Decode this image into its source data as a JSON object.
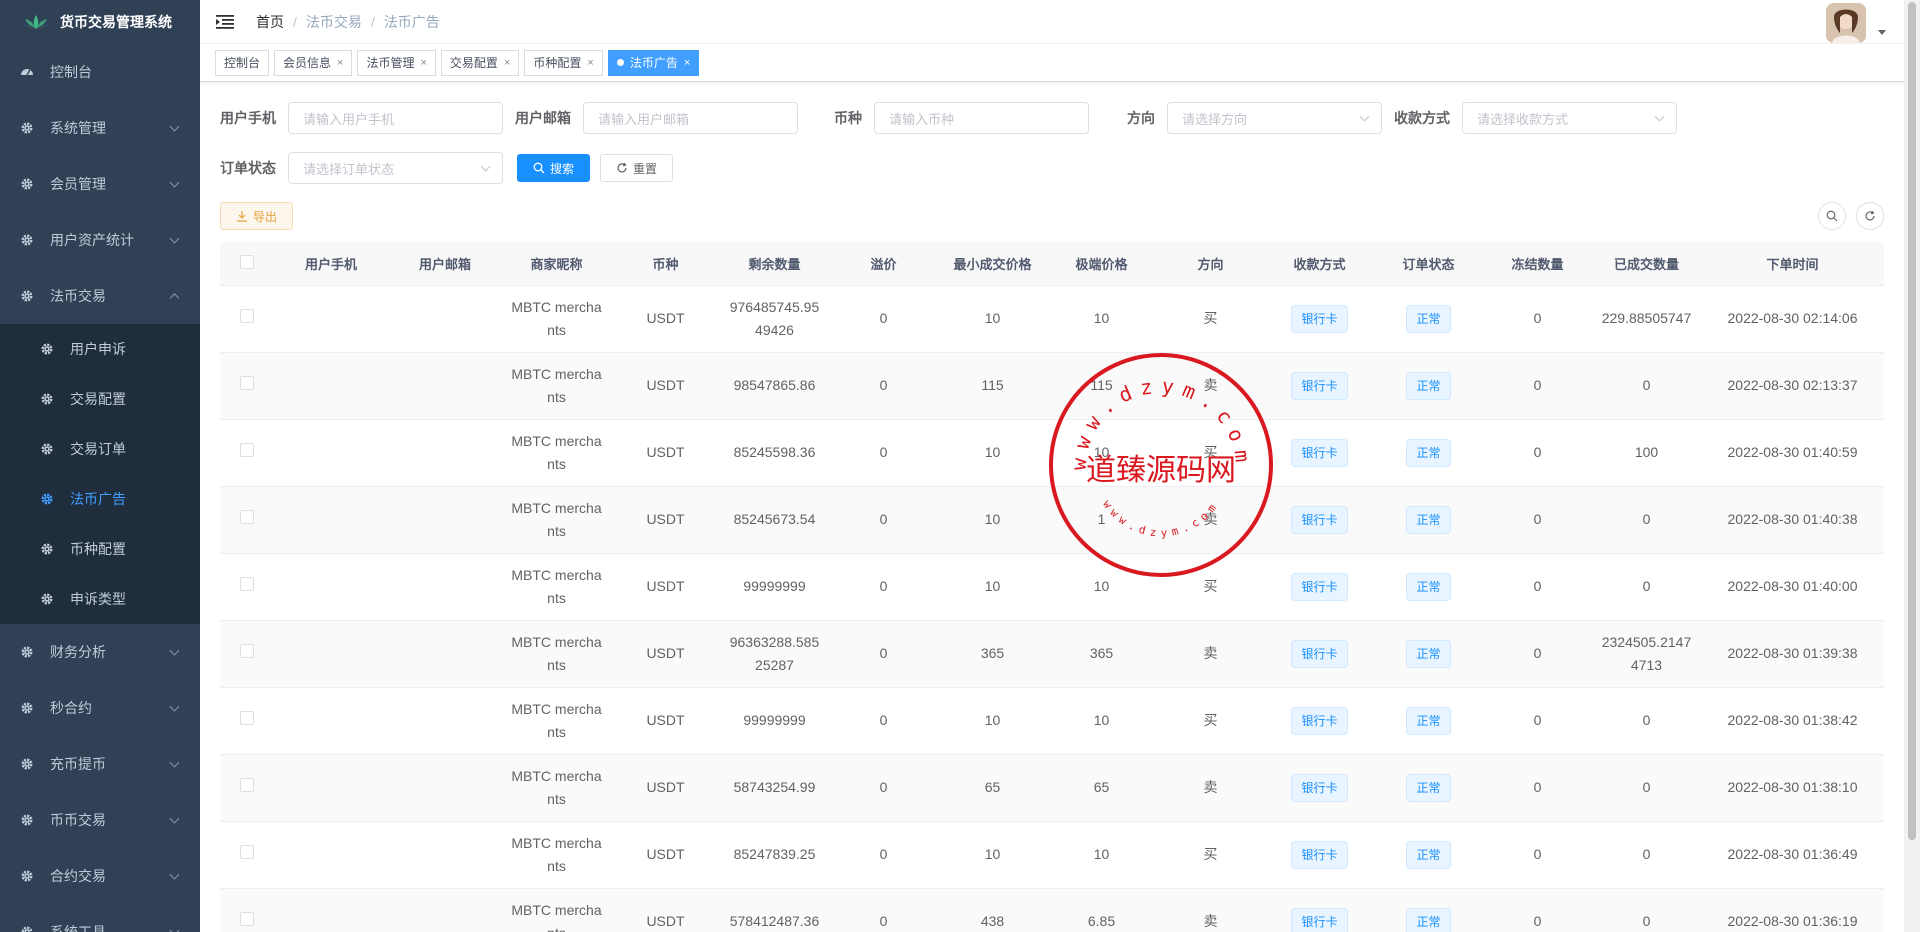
{
  "app": {
    "title": "货币交易管理系统"
  },
  "sidebar": {
    "items": [
      {
        "label": "控制台",
        "hasChildren": false
      },
      {
        "label": "系统管理",
        "hasChildren": true
      },
      {
        "label": "会员管理",
        "hasChildren": true
      },
      {
        "label": "用户资产统计",
        "hasChildren": true
      },
      {
        "label": "法币交易",
        "hasChildren": true,
        "open": true
      },
      {
        "label": "财务分析",
        "hasChildren": true
      },
      {
        "label": "秒合约",
        "hasChildren": true
      },
      {
        "label": "充币提币",
        "hasChildren": true
      },
      {
        "label": "币币交易",
        "hasChildren": true
      },
      {
        "label": "合约交易",
        "hasChildren": true
      }
    ],
    "fiat_children": [
      {
        "label": "用户申诉"
      },
      {
        "label": "交易配置"
      },
      {
        "label": "交易订单"
      },
      {
        "label": "法币广告",
        "active": true
      },
      {
        "label": "币种配置"
      },
      {
        "label": "申诉类型"
      }
    ],
    "last_item_label": "系统工具"
  },
  "header": {
    "breadcrumb": [
      "首页",
      "法币交易",
      "法币广告"
    ],
    "separator": "/"
  },
  "tags": [
    {
      "label": "控制台",
      "closable": false
    },
    {
      "label": "会员信息",
      "closable": true
    },
    {
      "label": "法币管理",
      "closable": true
    },
    {
      "label": "交易配置",
      "closable": true
    },
    {
      "label": "币种配置",
      "closable": true
    },
    {
      "label": "法币广告",
      "closable": true,
      "active": true
    }
  ],
  "filters": {
    "phone": {
      "label": "用户手机",
      "placeholder": "请输入用户手机"
    },
    "email": {
      "label": "用户邮箱",
      "placeholder": "请输入用户邮箱"
    },
    "coin": {
      "label": "币种",
      "placeholder": "请输入币种"
    },
    "direction": {
      "label": "方向",
      "placeholder": "请选择方向"
    },
    "payment": {
      "label": "收款方式",
      "placeholder": "请选择收款方式"
    },
    "status": {
      "label": "订单状态",
      "placeholder": "请选择订单状态"
    },
    "search_label": "搜索",
    "reset_label": "重置"
  },
  "toolbar": {
    "export_label": "导出"
  },
  "table": {
    "columns": [
      "用户手机",
      "用户邮箱",
      "商家昵称",
      "币种",
      "剩余数量",
      "溢价",
      "最小成交价格",
      "极端价格",
      "方向",
      "收款方式",
      "订单状态",
      "冻结数量",
      "已成交数量",
      "下单时间"
    ],
    "rows": [
      [
        "",
        "",
        "MBTC merchants",
        "USDT",
        "976485745.9549426",
        "0",
        "10",
        "10",
        "买",
        "银行卡",
        "正常",
        "0",
        "229.88505747",
        "2022-08-30 02:14:06"
      ],
      [
        "",
        "",
        "MBTC merchants",
        "USDT",
        "98547865.86",
        "0",
        "115",
        "115",
        "卖",
        "银行卡",
        "正常",
        "0",
        "0",
        "2022-08-30 02:13:37"
      ],
      [
        "",
        "",
        "MBTC merchants",
        "USDT",
        "85245598.36",
        "0",
        "10",
        "10",
        "买",
        "银行卡",
        "正常",
        "0",
        "100",
        "2022-08-30 01:40:59"
      ],
      [
        "",
        "",
        "MBTC merchants",
        "USDT",
        "85245673.54",
        "0",
        "10",
        "1",
        "卖",
        "银行卡",
        "正常",
        "0",
        "0",
        "2022-08-30 01:40:38"
      ],
      [
        "",
        "",
        "MBTC merchants",
        "USDT",
        "99999999",
        "0",
        "10",
        "10",
        "买",
        "银行卡",
        "正常",
        "0",
        "0",
        "2022-08-30 01:40:00"
      ],
      [
        "",
        "",
        "MBTC merchants",
        "USDT",
        "96363288.58525287",
        "0",
        "365",
        "365",
        "卖",
        "银行卡",
        "正常",
        "0",
        "2324505.21474713",
        "2022-08-30 01:39:38"
      ],
      [
        "",
        "",
        "MBTC merchants",
        "USDT",
        "99999999",
        "0",
        "10",
        "10",
        "买",
        "银行卡",
        "正常",
        "0",
        "0",
        "2022-08-30 01:38:42"
      ],
      [
        "",
        "",
        "MBTC merchants",
        "USDT",
        "58743254.99",
        "0",
        "65",
        "65",
        "卖",
        "银行卡",
        "正常",
        "0",
        "0",
        "2022-08-30 01:38:10"
      ],
      [
        "",
        "",
        "MBTC merchants",
        "USDT",
        "85247839.25",
        "0",
        "10",
        "10",
        "买",
        "银行卡",
        "正常",
        "0",
        "0",
        "2022-08-30 01:36:49"
      ],
      [
        "",
        "",
        "MBTC merchants",
        "USDT",
        "578412487.36",
        "0",
        "438",
        "6.85",
        "卖",
        "银行卡",
        "正常",
        "0",
        "0",
        "2022-08-30 01:36:19"
      ]
    ]
  },
  "watermark": {
    "text": "道臻源码网",
    "url_top": "www.dzym.com",
    "url_bottom": "www.dzym.com",
    "color": "#d9181f"
  }
}
